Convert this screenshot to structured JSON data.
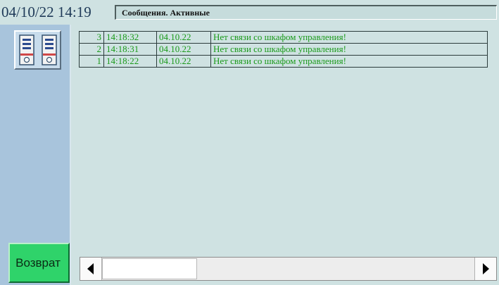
{
  "header": {
    "datetime": "04/10/22 14:19",
    "title": "Сообщения. Активные"
  },
  "sidebar": {
    "device_icon": "cabinet-icon",
    "back_label": "Возврат",
    "back_color": "#2fd36a"
  },
  "messages": [
    {
      "num": "3",
      "time": "14:18:32",
      "date": "04.10.22",
      "text": "Нет связи со шкафом управления!"
    },
    {
      "num": "2",
      "time": "14:18:31",
      "date": "04.10.22",
      "text": "Нет связи со шкафом управления!"
    },
    {
      "num": "1",
      "time": "14:18:22",
      "date": "04.10.22",
      "text": "Нет связи со шкафом управления!"
    }
  ],
  "colors": {
    "background": "#cfe2e2",
    "sidebar": "#a8c4dc",
    "message_text": "#1a9a1a"
  }
}
